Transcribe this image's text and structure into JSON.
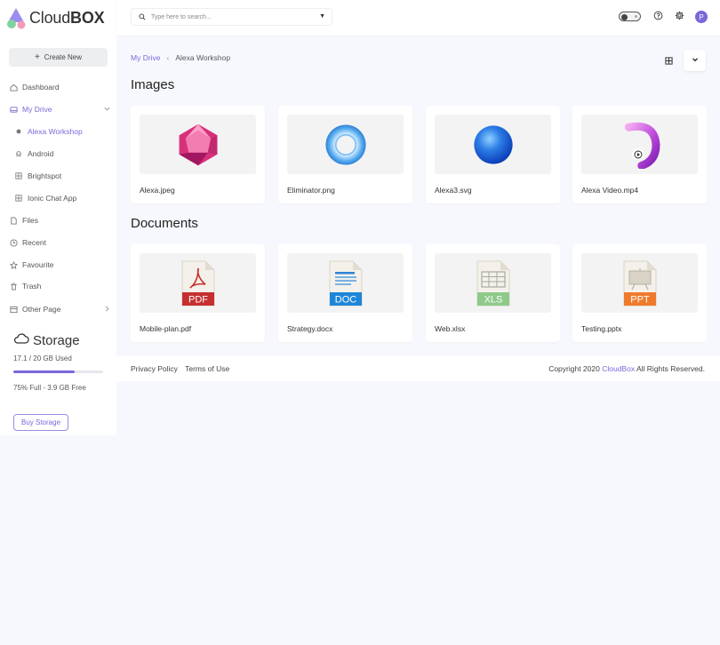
{
  "brand": {
    "name_light": "Cloud",
    "name_bold": "BOX"
  },
  "sidebar": {
    "create_label": "Create New",
    "items": [
      {
        "label": "Dashboard",
        "icon": "home-icon"
      },
      {
        "label": "My Drive",
        "icon": "drive-icon"
      },
      {
        "label": "Alexa Workshop",
        "icon": "dot-icon"
      },
      {
        "label": "Android",
        "icon": "android-icon"
      },
      {
        "label": "Brightspot",
        "icon": "grid-icon"
      },
      {
        "label": "Ionic Chat App",
        "icon": "grid-icon"
      },
      {
        "label": "Files",
        "icon": "file-icon"
      },
      {
        "label": "Recent",
        "icon": "clock-icon"
      },
      {
        "label": "Favourite",
        "icon": "star-icon"
      },
      {
        "label": "Trash",
        "icon": "trash-icon"
      },
      {
        "label": "Other Page",
        "icon": "page-icon"
      }
    ],
    "storage": {
      "title": "Storage",
      "used_text": "17.1 / 20 GB Used",
      "used_fraction": 0.68,
      "free_text": "75% Full - 3.9 GB Free",
      "buy_label": "Buy Storage"
    }
  },
  "header": {
    "search_placeholder": "Type here to search...",
    "avatar_initial": "P"
  },
  "breadcrumb": {
    "root": "My Drive",
    "current": "Alexa Workshop"
  },
  "sections": {
    "images_title": "Images",
    "documents_title": "Documents"
  },
  "images": [
    {
      "name": "Alexa.jpeg"
    },
    {
      "name": "Eliminator.png"
    },
    {
      "name": "Alexa3.svg"
    },
    {
      "name": "Alexa Video.mp4"
    }
  ],
  "documents": [
    {
      "name": "Mobile-plan.pdf",
      "tag": "PDF",
      "color": "#c62f2f"
    },
    {
      "name": "Strategy.docx",
      "tag": "DOC",
      "color": "#1d86d8"
    },
    {
      "name": "Web.xlsx",
      "tag": "XLS",
      "color": "#8ec98a"
    },
    {
      "name": "Testing.pptx",
      "tag": "PPT",
      "color": "#f07a2c"
    }
  ],
  "footer": {
    "privacy": "Privacy Policy",
    "terms": "Terms of Use",
    "copyright_prefix": "Copyright 2020",
    "copyright_brand": "CloudBox",
    "copyright_suffix": "All Rights Reserved."
  },
  "colors": {
    "accent": "#7b68d9"
  }
}
